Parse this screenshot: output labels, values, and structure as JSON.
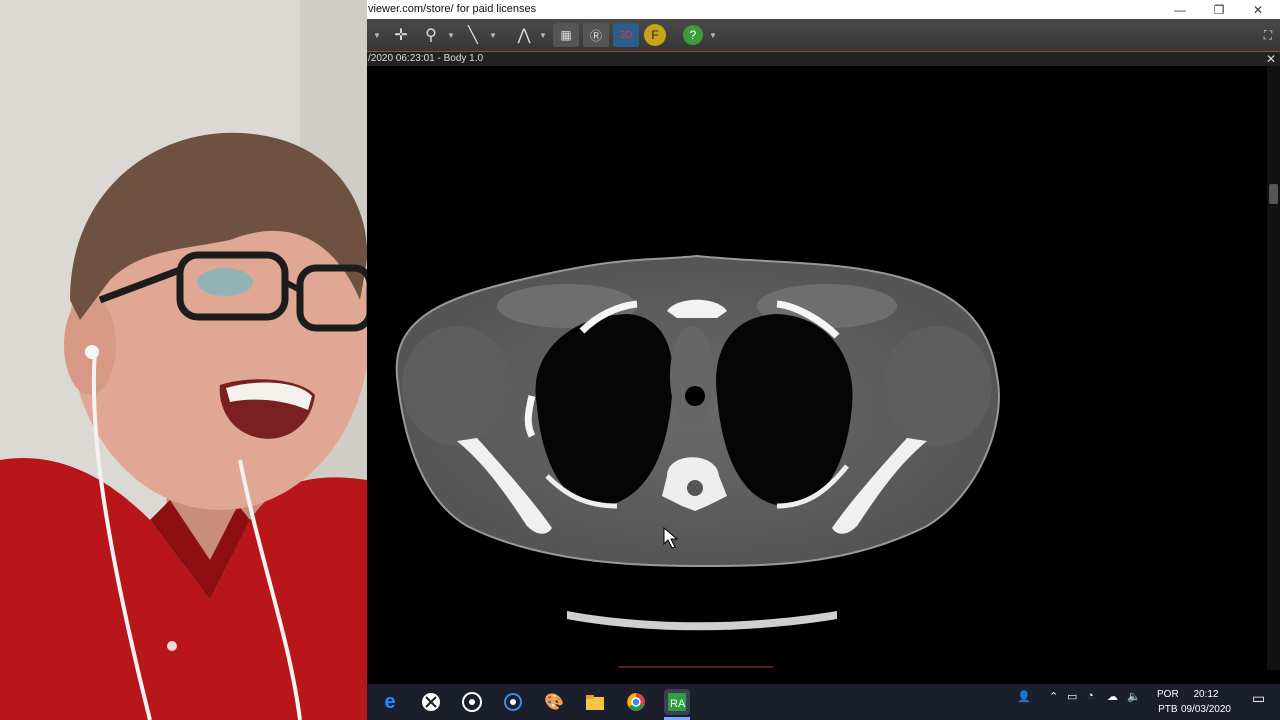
{
  "window": {
    "title": "viewer.com/store/ for paid licenses",
    "controls": {
      "minimize": "—",
      "maximize": "❐",
      "close": "✕"
    }
  },
  "toolbar": {
    "tools": [
      {
        "name": "pan-tool",
        "glyph": "✛"
      },
      {
        "name": "zoom-tool",
        "glyph": "⚲"
      },
      {
        "name": "measure-tool",
        "glyph": "╲"
      },
      {
        "name": "mpr-tool",
        "glyph": "⋀"
      },
      {
        "name": "film-tool",
        "glyph": "▦"
      },
      {
        "name": "rotate-tool",
        "glyph": "Ⓡ"
      },
      {
        "name": "3d-tool",
        "glyph": "3D"
      },
      {
        "name": "fusion-tool",
        "glyph": "F"
      },
      {
        "name": "help-tool",
        "glyph": "?"
      }
    ]
  },
  "viewer": {
    "header_info": "/2020 06:23:01 -  Body 1.0",
    "close": "✕"
  },
  "taskbar": {
    "language": {
      "line1": "POR",
      "line2": "PTB"
    },
    "clock": {
      "time": "20:12",
      "date": "09/03/2020"
    },
    "app_icons": [
      "edge-icon",
      "xbox-icon",
      "obs-icon",
      "cortana-icon",
      "paint-icon",
      "explorer-icon",
      "chrome-icon",
      "radiant-icon"
    ]
  },
  "colors": {
    "accent": "#9a4b3a",
    "taskbar": "#1b1e2b",
    "toolbar": "#3e3e3e"
  }
}
